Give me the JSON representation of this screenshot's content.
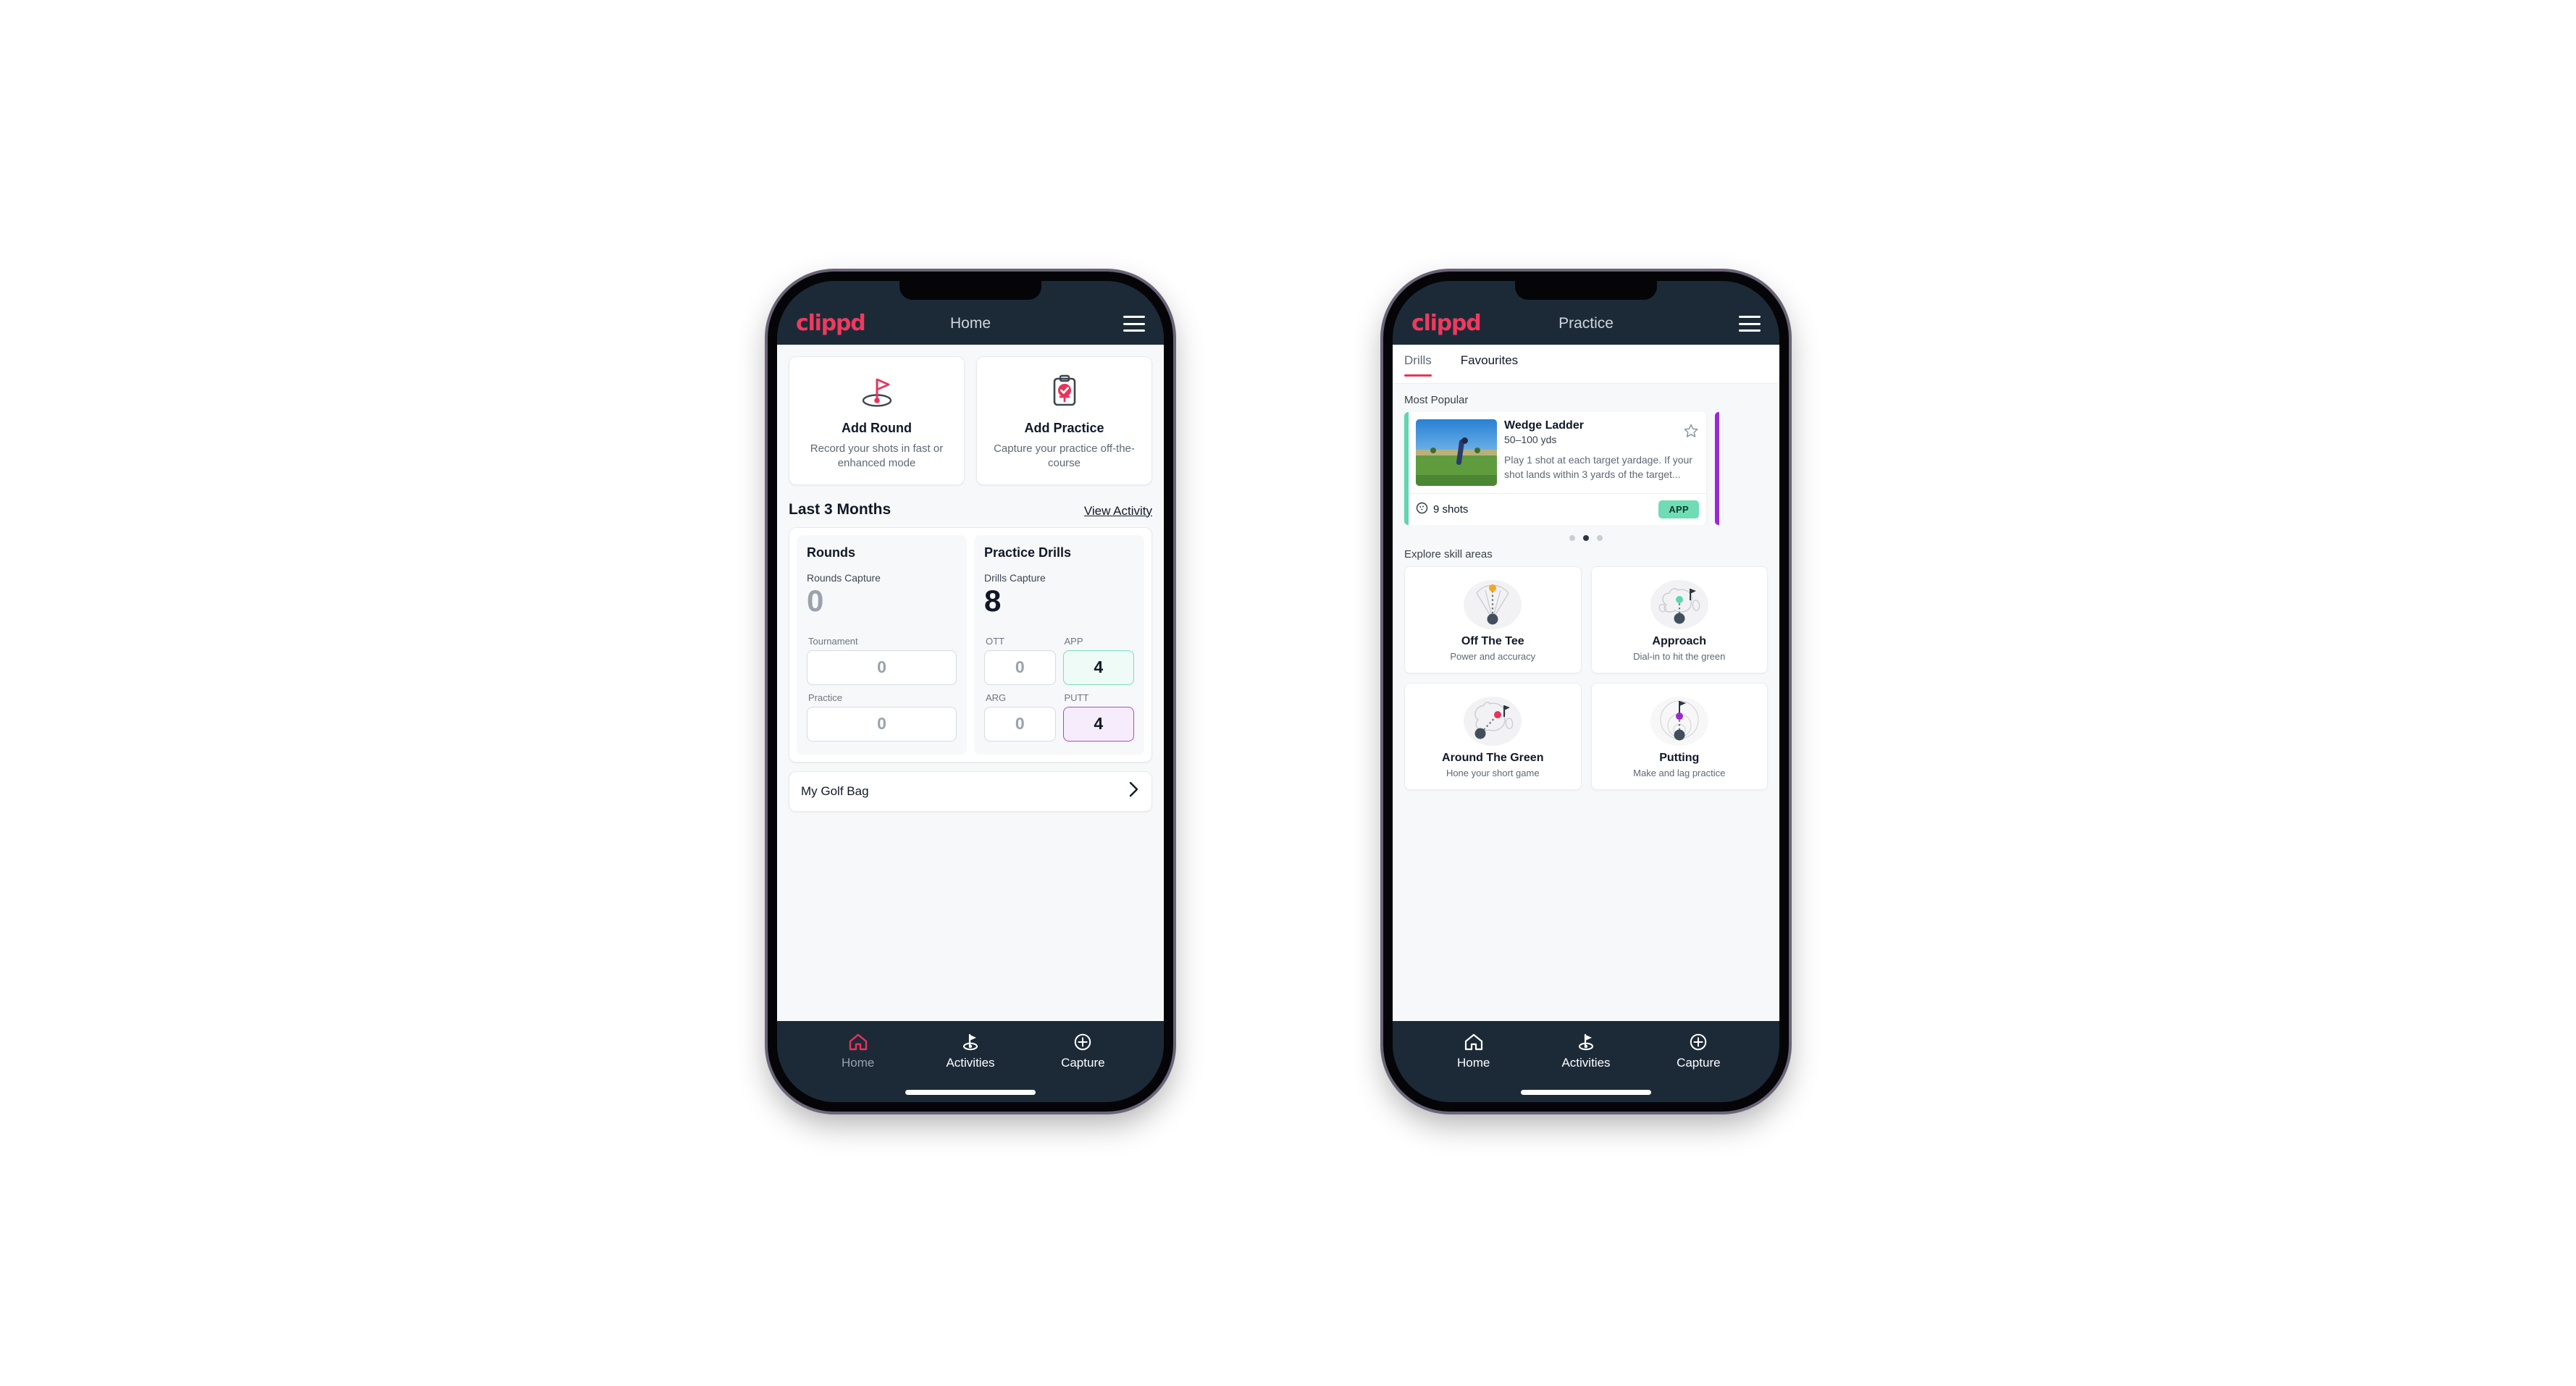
{
  "brand": "clippd",
  "phones": {
    "home": {
      "title": "Home",
      "action_cards": [
        {
          "icon": "golf-flag-icon",
          "title": "Add Round",
          "subtitle": "Record your shots in fast or enhanced mode"
        },
        {
          "icon": "clipboard-check-icon",
          "title": "Add Practice",
          "subtitle": "Capture your practice off-the-course"
        }
      ],
      "section": {
        "title": "Last 3 Months",
        "link": "View Activity"
      },
      "rounds": {
        "heading": "Rounds",
        "capture_label": "Rounds Capture",
        "capture_value": "0",
        "fields": [
          {
            "label": "Tournament",
            "value": "0"
          },
          {
            "label": "Practice",
            "value": "0"
          }
        ]
      },
      "drills": {
        "heading": "Practice Drills",
        "capture_label": "Drills Capture",
        "capture_value": "8",
        "fields": [
          {
            "label": "OTT",
            "value": "0",
            "accent": "none"
          },
          {
            "label": "APP",
            "value": "4",
            "accent": "#7bdcbb"
          },
          {
            "label": "ARG",
            "value": "0",
            "accent": "none"
          },
          {
            "label": "PUTT",
            "value": "4",
            "accent": "#ab47d6"
          }
        ]
      },
      "golf_bag": {
        "label": "My Golf Bag",
        "chevron": "chevron-right-icon"
      },
      "bottom_nav": [
        {
          "label": "Home",
          "icon": "home-icon",
          "active": true
        },
        {
          "label": "Activities",
          "icon": "golf-flag-icon",
          "active": false
        },
        {
          "label": "Capture",
          "icon": "plus-circle-icon",
          "active": false
        }
      ]
    },
    "practice": {
      "title": "Practice",
      "tabs": [
        {
          "label": "Drills",
          "active": true
        },
        {
          "label": "Favourites",
          "active": false
        }
      ],
      "most_popular_label": "Most Popular",
      "drill_card": {
        "title": "Wedge Ladder",
        "subtitle": "50–100 yds",
        "description": "Play 1 shot at each target yardage. If your shot lands within 3 yards of the target...",
        "shots": "9 shots",
        "shots_icon": "golf-ball-icon",
        "tag": "APP",
        "tag_color": "#6fdcb5",
        "accent_color": "#5fd6ae",
        "favourite_icon": "star-outline-icon",
        "thumbnail": "golfer-chipping-photo"
      },
      "next_card_accent": "#9b27d6",
      "carousel_dots": {
        "count": 3,
        "active_index": 1
      },
      "explore_label": "Explore skill areas",
      "skill_cards": [
        {
          "title": "Off The Tee",
          "subtitle": "Power and accuracy",
          "icon": "tee-shot-dispersion-icon",
          "dot_color": "#f5a623"
        },
        {
          "title": "Approach",
          "subtitle": "Dial-in to hit the green",
          "icon": "green-approach-icon",
          "dot_color": "#5fd6ae"
        },
        {
          "title": "Around The Green",
          "subtitle": "Hone your short game",
          "icon": "chip-to-green-icon",
          "dot_color": "#e8335a"
        },
        {
          "title": "Putting",
          "subtitle": "Make and lag practice",
          "icon": "putting-rings-icon",
          "dot_color": "#9b27d6"
        }
      ],
      "bottom_nav": [
        {
          "label": "Home",
          "icon": "home-icon",
          "active": false
        },
        {
          "label": "Activities",
          "icon": "golf-flag-icon",
          "active": false
        },
        {
          "label": "Capture",
          "icon": "plus-circle-icon",
          "active": false
        }
      ]
    }
  },
  "colors": {
    "brand_pink": "#ef3a5d",
    "appbar": "#1c2a38",
    "app_green": "#7bdcbb",
    "putt_purple": "#ab47d6",
    "tab_underline": "#e8335a"
  }
}
